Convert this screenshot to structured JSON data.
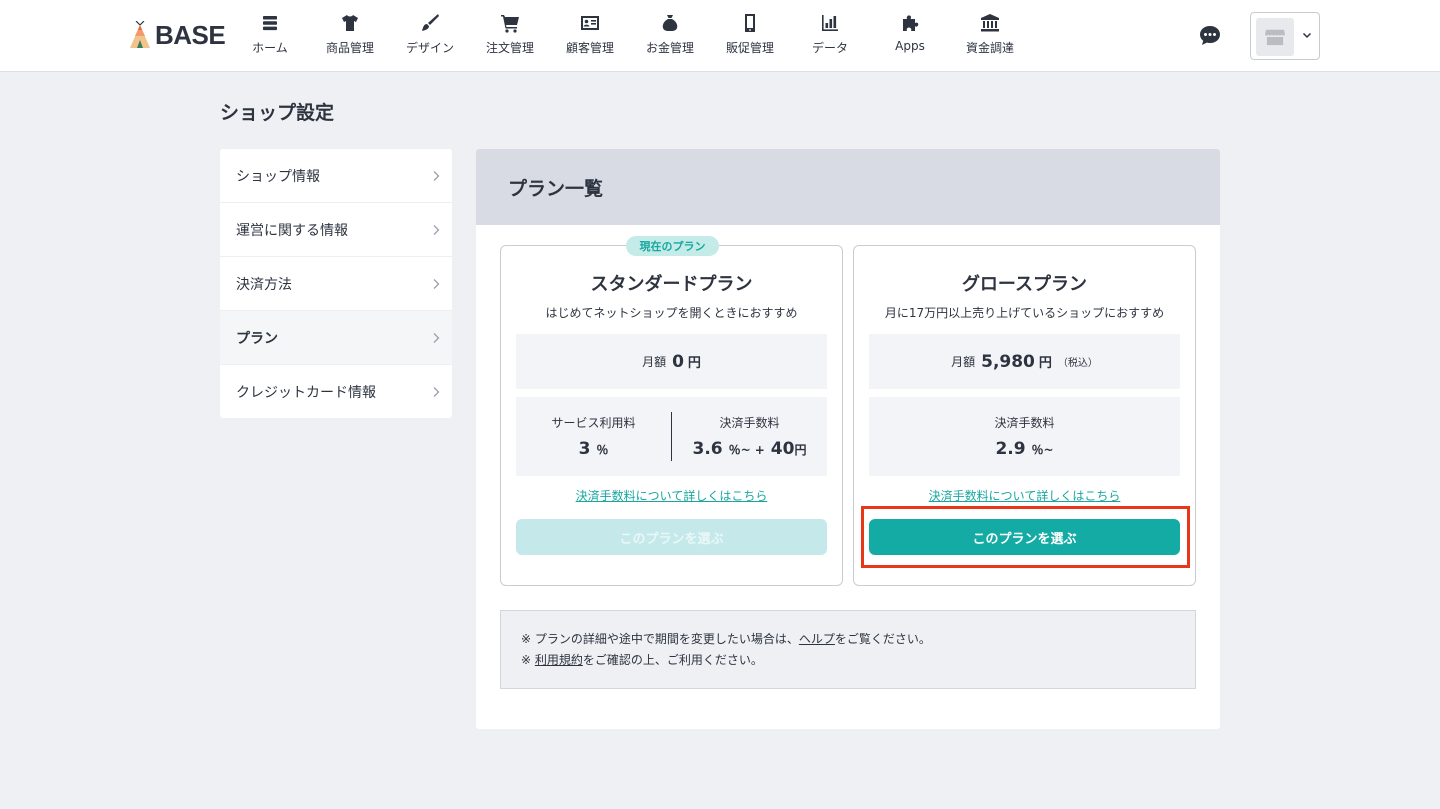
{
  "brand": {
    "name": "BASE"
  },
  "nav": [
    {
      "label": "ホーム",
      "icon": "home-icon"
    },
    {
      "label": "商品管理",
      "icon": "tshirt-icon"
    },
    {
      "label": "デザイン",
      "icon": "brush-icon"
    },
    {
      "label": "注文管理",
      "icon": "cart-icon"
    },
    {
      "label": "顧客管理",
      "icon": "customer-card-icon"
    },
    {
      "label": "お金管理",
      "icon": "money-bag-icon"
    },
    {
      "label": "販促管理",
      "icon": "smartphone-icon"
    },
    {
      "label": "データ",
      "icon": "bar-chart-icon"
    },
    {
      "label": "Apps",
      "icon": "puzzle-icon"
    },
    {
      "label": "資金調達",
      "icon": "bank-icon"
    }
  ],
  "page_title": "ショップ設定",
  "sidemenu": [
    {
      "label": "ショップ情報"
    },
    {
      "label": "運営に関する情報"
    },
    {
      "label": "決済方法"
    },
    {
      "label": "プラン",
      "active": true
    },
    {
      "label": "クレジットカード情報"
    }
  ],
  "panel": {
    "title": "プラン一覧",
    "standard": {
      "badge": "現在のプラン",
      "name": "スタンダードプラン",
      "desc": "はじめてネットショップを開くときにおすすめ",
      "price_prefix": "月額",
      "price_amount": "0",
      "price_unit": "円",
      "fee1_label": "サービス利用料",
      "fee1_value": "3",
      "fee1_unit": "％",
      "fee2_label": "決済手数料",
      "fee2_value": "3.6",
      "fee2_unit": "％~ +",
      "fee2_value2": "40",
      "fee2_unit2": "円",
      "link": "決済手数料について詳しくはこちら",
      "button": "このプランを選ぶ"
    },
    "growth": {
      "name": "グロースプラン",
      "desc": "月に17万円以上売り上げているショップにおすすめ",
      "price_prefix": "月額",
      "price_amount": "5,980",
      "price_unit": "円",
      "price_tax": "（税込）",
      "fee_label": "決済手数料",
      "fee_value": "2.9",
      "fee_unit": "％~",
      "link": "決済手数料について詳しくはこちら",
      "button": "このプランを選ぶ"
    },
    "notes": {
      "line1_prefix": "※ プランの詳細や途中で期間を変更したい場合は、",
      "line1_link": "ヘルプ",
      "line1_suffix": "をご覧ください。",
      "line2_prefix": "※ ",
      "line2_link": "利用規約",
      "line2_suffix": "をご確認の上、ご利用ください。"
    }
  },
  "colors": {
    "accent": "#13aba4",
    "highlight": "#e8361b",
    "badge_bg": "#c5ebe9"
  }
}
